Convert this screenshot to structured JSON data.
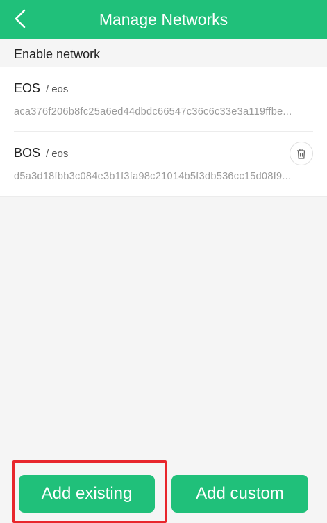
{
  "header": {
    "title": "Manage Networks"
  },
  "section": {
    "label": "Enable network"
  },
  "networks": [
    {
      "name": "EOS",
      "separator": "/",
      "protocol": "eos",
      "chain_id": "aca376f206b8fc25a6ed44dbdc66547c36c6c33e3a119ffbe...",
      "deletable": false
    },
    {
      "name": "BOS",
      "separator": "/",
      "protocol": "eos",
      "chain_id": "d5a3d18fbb3c084e3b1f3fa98c21014b5f3db536cc15d08f9...",
      "deletable": true
    }
  ],
  "buttons": {
    "add_existing": "Add existing",
    "add_custom": "Add custom"
  },
  "colors": {
    "accent": "#20c07a",
    "highlight": "#e8262c",
    "background": "#f5f5f5"
  },
  "icons": {
    "back": "chevron-left-icon",
    "delete": "trash-icon"
  }
}
